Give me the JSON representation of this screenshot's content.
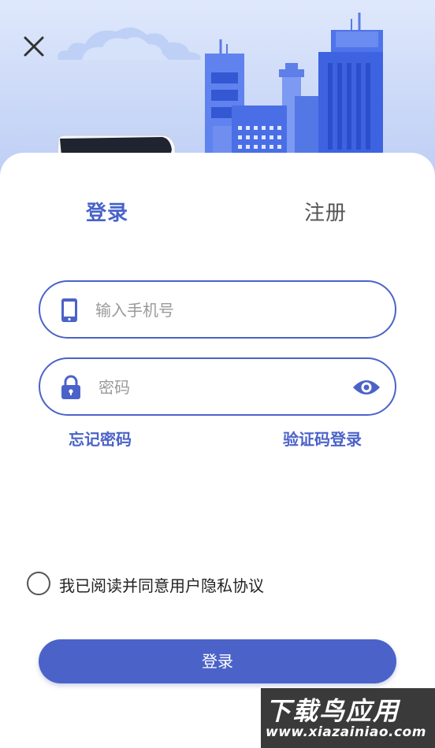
{
  "tabs": [
    {
      "label": "登录",
      "active": true
    },
    {
      "label": "注册",
      "active": false
    }
  ],
  "phone_field": {
    "placeholder": "输入手机号",
    "icon": "phone-icon"
  },
  "password_field": {
    "placeholder": "密码",
    "icon": "lock-icon",
    "toggle_icon": "eye-icon"
  },
  "links": {
    "forgot": "忘记密码",
    "sms_login": "验证码登录"
  },
  "agreement": {
    "text": "我已阅读并同意用户隐私协议",
    "checked": false
  },
  "submit_label": "登录",
  "watermark": {
    "main": "下载鸟应用",
    "sub": "www.xiazainiao.com"
  },
  "colors": {
    "accent": "#4b63c8",
    "hero_bg": "#c9d7f7"
  }
}
